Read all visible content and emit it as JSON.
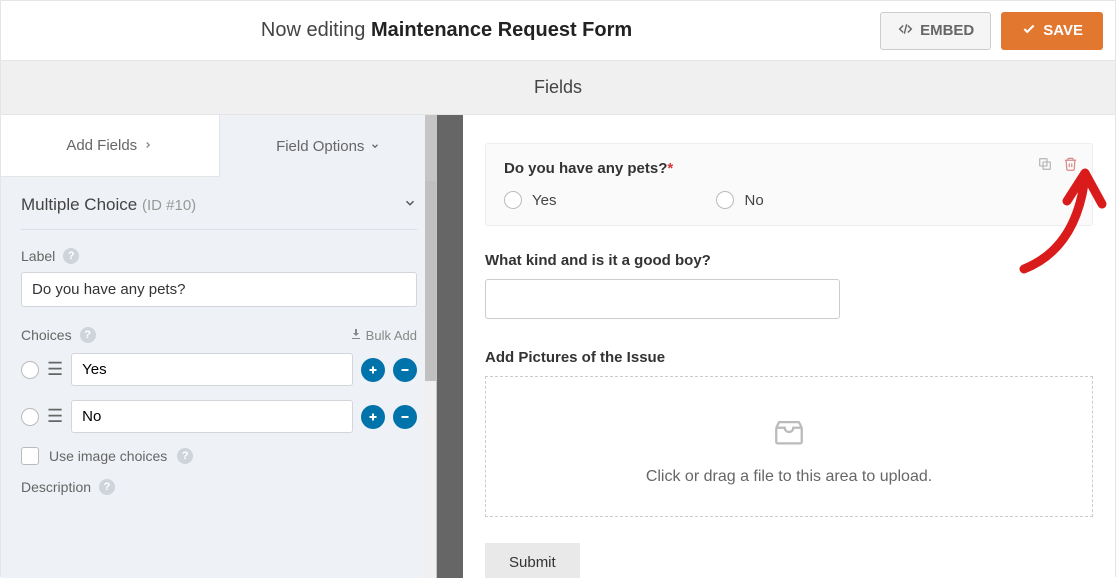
{
  "header": {
    "editing_prefix": "Now editing",
    "form_title": "Maintenance Request Form",
    "embed_label": "EMBED",
    "save_label": "SAVE"
  },
  "fields_bar": {
    "label": "Fields"
  },
  "tabs": {
    "add_fields": "Add Fields",
    "field_options": "Field Options"
  },
  "panel": {
    "type": "Multiple Choice",
    "id_text": "(ID #10)",
    "label_heading": "Label",
    "label_value": "Do you have any pets?",
    "choices_heading": "Choices",
    "bulk_add": "Bulk Add",
    "choices": [
      "Yes",
      "No"
    ],
    "image_choices": "Use image choices",
    "description_heading": "Description"
  },
  "preview": {
    "question_label": "Do you have any pets?",
    "options": [
      "Yes",
      "No"
    ],
    "secondary_question": "What kind and is it a good boy?",
    "upload_heading": "Add Pictures of the Issue",
    "upload_text": "Click or drag a file to this area to upload.",
    "submit": "Submit"
  }
}
